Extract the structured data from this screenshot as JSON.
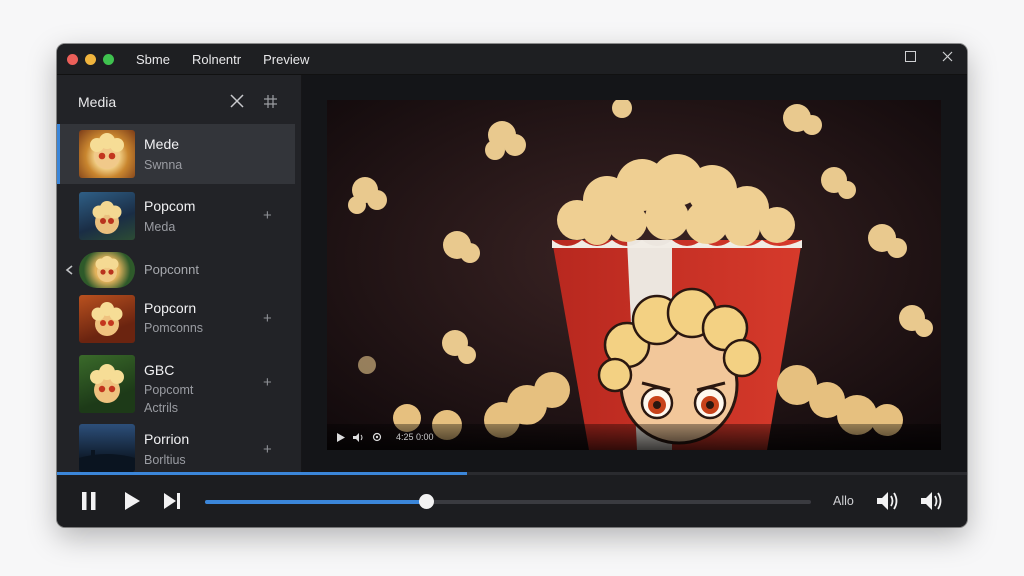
{
  "titlebar": {
    "menu": [
      "Sbme",
      "Rolnentr",
      "Preview"
    ]
  },
  "sidebar": {
    "title": "Media",
    "items": [
      {
        "title": "Mede",
        "subtitle": "Swnna",
        "active": true
      },
      {
        "title": "Popcom",
        "subtitle": "Meda"
      },
      {
        "title": "Popconnt",
        "subtitle": ""
      },
      {
        "title": "Popcorn",
        "subtitle": "Pomconns"
      },
      {
        "title": "GBC",
        "subtitle": "Popcomt",
        "subtitle2": "Actrils"
      },
      {
        "title": "Porrion",
        "subtitle": "Borltius"
      }
    ]
  },
  "video": {
    "time": "4:25 0:00"
  },
  "controls": {
    "progress": 0.45,
    "seek_progress": 0.365,
    "auto_label": "Allo"
  },
  "colors": {
    "accent": "#3b86d9",
    "window_bg": "#1b1c1f",
    "sidebar_bg": "#222327",
    "active_item_bg": "#33353a"
  },
  "icons": [
    "close-icon",
    "grip-icon",
    "plus-icon",
    "play-icon",
    "pause-icon",
    "skip-next-icon",
    "volume-icon",
    "maximize-icon"
  ]
}
